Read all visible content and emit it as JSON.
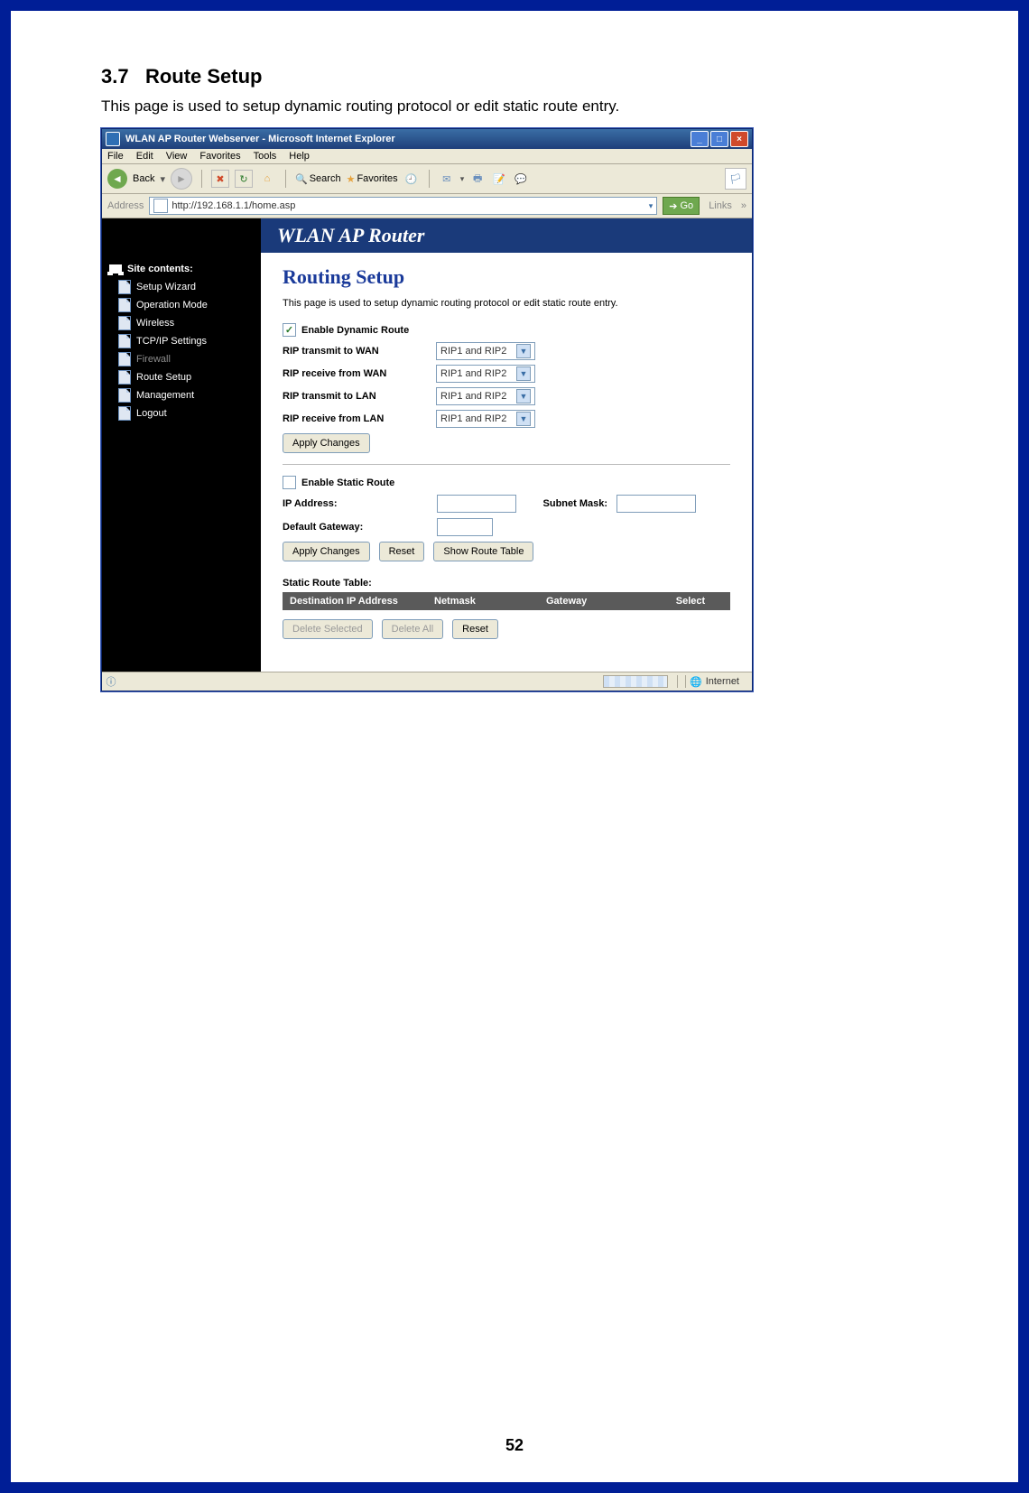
{
  "doc": {
    "heading_number": "3.7",
    "heading_text": "Route Setup",
    "intro": "This page is used to setup dynamic routing protocol or edit static route entry.",
    "page_number": "52"
  },
  "ie": {
    "title": "WLAN AP Router Webserver - Microsoft Internet Explorer",
    "menu": {
      "file": "File",
      "edit": "Edit",
      "view": "View",
      "favorites": "Favorites",
      "tools": "Tools",
      "help": "Help"
    },
    "toolbar": {
      "back": "Back",
      "search": "Search",
      "favorites": "Favorites"
    },
    "address_label": "Address",
    "address_value": "http://192.168.1.1/home.asp",
    "go": "Go",
    "links": "Links",
    "status_zone": "Internet"
  },
  "sidebar": {
    "title": "Site contents:",
    "items": [
      "Setup Wizard",
      "Operation Mode",
      "Wireless",
      "TCP/IP Settings",
      "Firewall",
      "Route Setup",
      "Management",
      "Logout"
    ]
  },
  "banner": "WLAN AP Router",
  "page": {
    "title": "Routing Setup",
    "desc": "This page is used to setup dynamic routing protocol or edit static route entry.",
    "dyn": {
      "enable_label": "Enable Dynamic Route",
      "rows": [
        {
          "label": "RIP transmit to WAN",
          "value": "RIP1 and RIP2"
        },
        {
          "label": "RIP receive from WAN",
          "value": "RIP1 and RIP2"
        },
        {
          "label": "RIP transmit to LAN",
          "value": "RIP1 and RIP2"
        },
        {
          "label": "RIP receive from LAN",
          "value": "RIP1 and RIP2"
        }
      ],
      "apply": "Apply Changes"
    },
    "stat": {
      "enable_label": "Enable Static Route",
      "ip_label": "IP Address:",
      "subnet_label": "Subnet Mask:",
      "gw_label": "Default Gateway:",
      "apply": "Apply Changes",
      "reset": "Reset",
      "show": "Show Route Table"
    },
    "table": {
      "title": "Static Route Table:",
      "headers": {
        "dest": "Destination IP Address",
        "netmask": "Netmask",
        "gateway": "Gateway",
        "select": "Select"
      },
      "btns": {
        "del_sel": "Delete Selected",
        "del_all": "Delete All",
        "reset": "Reset"
      }
    }
  }
}
